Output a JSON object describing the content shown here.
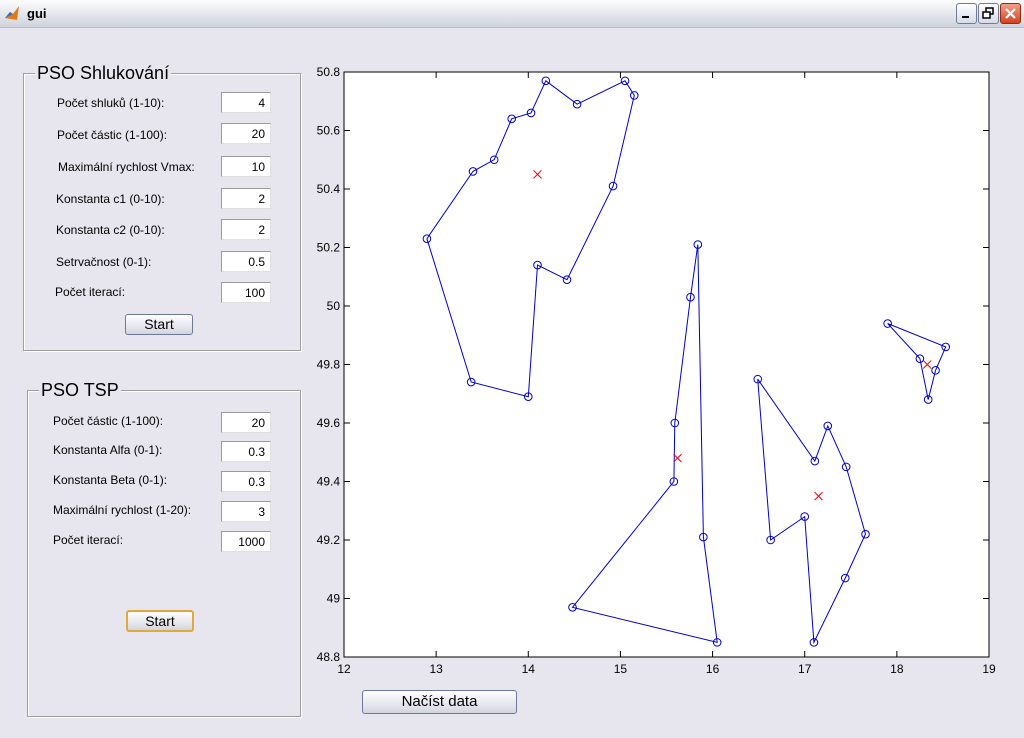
{
  "window": {
    "title": "gui",
    "icon": "matlab-icon"
  },
  "window_buttons": [
    "minimize-icon",
    "restore-icon",
    "close-icon"
  ],
  "shluk": {
    "title": "PSO Shlukování",
    "fields": [
      {
        "label": "Počet shluků (1-10):",
        "value": "4"
      },
      {
        "label": "Počet částic (1-100):",
        "value": "20"
      },
      {
        "label": "Maximální rychlost Vmax:",
        "value": "10"
      },
      {
        "label": "Konstanta c1 (0-10):",
        "value": "2"
      },
      {
        "label": "Konstanta c2 (0-10):",
        "value": "2"
      },
      {
        "label": "Setrvačnost (0-1):",
        "value": "0.5"
      },
      {
        "label": "Počet iterací:",
        "value": "100"
      }
    ],
    "start_label": "Start"
  },
  "tsp": {
    "title": "PSO TSP",
    "fields": [
      {
        "label": "Počet částic (1-100):",
        "value": "20"
      },
      {
        "label": "Konstanta Alfa (0-1):",
        "value": "0.3"
      },
      {
        "label": "Konstanta Beta (0-1):",
        "value": "0.3"
      },
      {
        "label": "Maximální rychlost (1-20):",
        "value": "3"
      },
      {
        "label": "Počet iterací:",
        "value": "1000"
      }
    ],
    "start_label": "Start"
  },
  "load_button_label": "Načíst data",
  "chart_data": {
    "type": "line",
    "xlim": [
      12,
      19
    ],
    "ylim": [
      48.8,
      50.8
    ],
    "xticks": [
      12,
      13,
      14,
      15,
      16,
      17,
      18,
      19
    ],
    "yticks": [
      48.8,
      49,
      49.2,
      49.4,
      49.6,
      49.8,
      50,
      50.2,
      50.4,
      50.6,
      50.8
    ],
    "line_color": "#0000c8",
    "center_color": "#ff0000",
    "series": [
      {
        "values": [
          [
            12.9,
            50.23
          ],
          [
            13.4,
            50.46
          ],
          [
            13.63,
            50.5
          ],
          [
            13.82,
            50.64
          ],
          [
            14.03,
            50.66
          ],
          [
            14.19,
            50.77
          ],
          [
            14.53,
            50.69
          ],
          [
            15.05,
            50.77
          ],
          [
            15.15,
            50.72
          ],
          [
            14.92,
            50.41
          ],
          [
            14.42,
            50.09
          ],
          [
            14.1,
            50.14
          ],
          [
            14,
            49.69
          ],
          [
            13.38,
            49.74
          ],
          [
            12.9,
            50.23
          ]
        ]
      },
      {
        "values": [
          [
            15.84,
            50.21
          ],
          [
            15.76,
            50.03
          ],
          [
            15.59,
            49.6
          ],
          [
            15.58,
            49.4
          ],
          [
            14.48,
            48.97
          ],
          [
            16.05,
            48.85
          ],
          [
            15.9,
            49.21
          ],
          [
            15.84,
            50.21
          ]
        ]
      },
      {
        "values": [
          [
            16.49,
            49.75
          ],
          [
            16.63,
            49.2
          ],
          [
            17.0,
            49.28
          ],
          [
            17.1,
            48.85
          ],
          [
            17.44,
            49.07
          ],
          [
            17.66,
            49.22
          ],
          [
            17.45,
            49.45
          ],
          [
            17.25,
            49.59
          ],
          [
            17.11,
            49.47
          ],
          [
            16.49,
            49.75
          ]
        ]
      },
      {
        "values": [
          [
            17.9,
            49.94
          ],
          [
            18.53,
            49.86
          ],
          [
            18.42,
            49.78
          ],
          [
            18.34,
            49.68
          ],
          [
            18.25,
            49.82
          ],
          [
            17.9,
            49.94
          ]
        ]
      }
    ],
    "centers": [
      [
        14.1,
        50.45
      ],
      [
        15.62,
        49.48
      ],
      [
        17.15,
        49.35
      ],
      [
        18.33,
        49.8
      ]
    ]
  }
}
